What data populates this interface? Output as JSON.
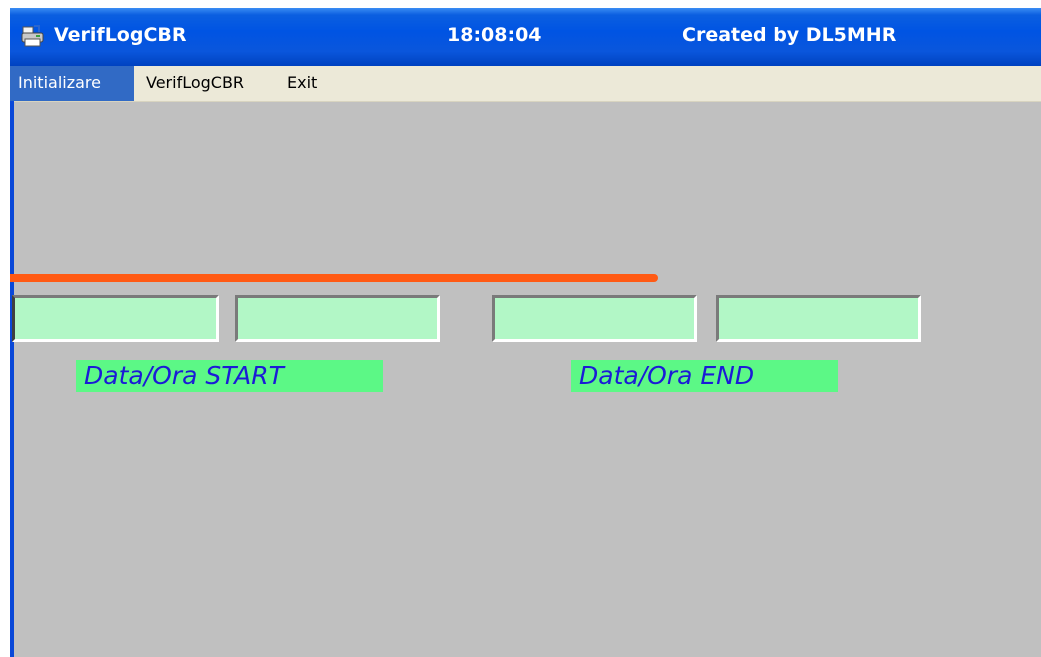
{
  "window": {
    "title": "VerifLogCBR",
    "clock": "18:08:04",
    "credit": "Created by DL5MHR",
    "icon": "printer-icon"
  },
  "menu": {
    "items": [
      {
        "label": "Initializare",
        "selected": true
      },
      {
        "label": "VerifLogCBR",
        "selected": false
      },
      {
        "label": "Exit",
        "selected": false
      }
    ]
  },
  "fields": {
    "start_date": {
      "value": ""
    },
    "start_time": {
      "value": ""
    },
    "end_date": {
      "value": ""
    },
    "end_time": {
      "value": ""
    }
  },
  "labels": {
    "start": "Data/Ora START",
    "end": "Data/Ora END"
  },
  "colors": {
    "titlebar": "#0054e3",
    "menu_selected": "#316ac5",
    "client_bg": "#c0c0c0",
    "field_bg": "#b2f7c6",
    "label_bg": "#5cf886",
    "label_text": "#1b1bd6",
    "divider": "#ff5a14"
  }
}
